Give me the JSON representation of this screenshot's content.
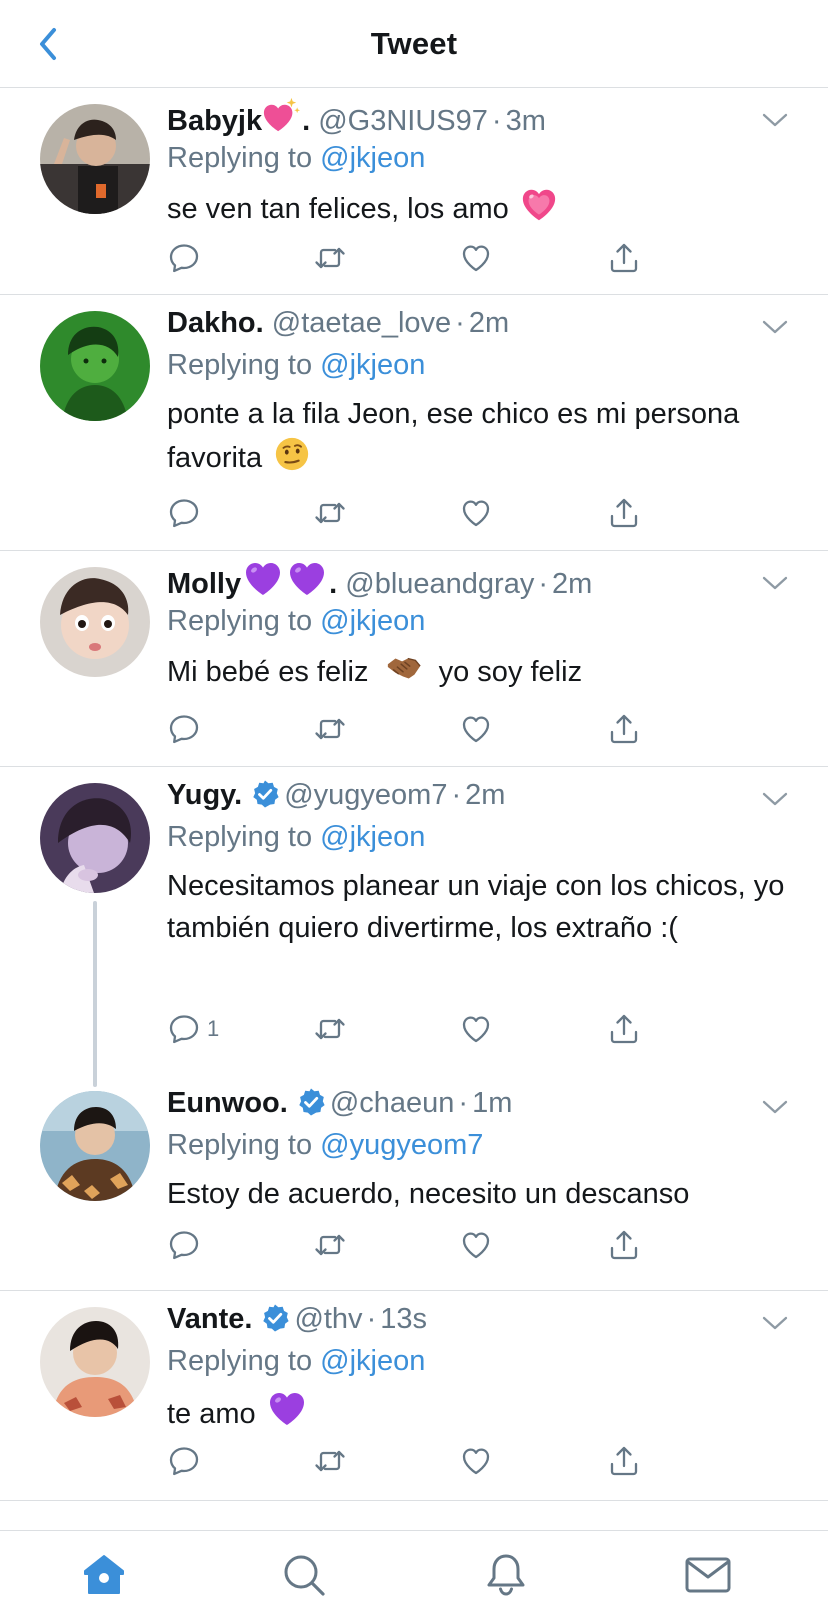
{
  "header": {
    "title": "Tweet",
    "back_icon": "chevron-left-icon"
  },
  "colors": {
    "accent": "#3b8fd9",
    "muted": "#657786",
    "divider": "#dcdfe2",
    "verified": "#3b8fd9"
  },
  "tweets": [
    {
      "name": "Babyjk",
      "name_suffix": ".",
      "name_emoji": "sparkling-pink-heart",
      "handle": "@G3NIUS97",
      "time": "3m",
      "replying_prefix": "Replying to",
      "replying_to": "@jkjeon",
      "text": "se ven tan felices, los amo",
      "text_emoji": "growing-pink-heart",
      "verified": false,
      "reply_count": ""
    },
    {
      "name": "Dakho.",
      "handle": "@taetae_love",
      "time": "2m",
      "replying_prefix": "Replying to",
      "replying_to": "@jkjeon",
      "text": "ponte a la fila Jeon, ese chico es mi persona favorita",
      "text_emoji": "raised-eyebrow-face",
      "verified": false,
      "reply_count": ""
    },
    {
      "name": "Molly",
      "name_suffix": ".",
      "name_emoji": "purple-heart",
      "handle": "@blueandgray",
      "time": "2m",
      "replying_prefix": "Replying to",
      "replying_to": "@jkjeon",
      "text_before": "Mi bebé es feliz",
      "text_after": "yo soy feliz",
      "text_emoji": "handshake",
      "verified": false,
      "reply_count": ""
    },
    {
      "name": "Yugy.",
      "handle": "@yugyeom7",
      "time": "2m",
      "replying_prefix": "Replying to",
      "replying_to": "@jkjeon",
      "text": "Necesitamos planear un viaje con los chicos, yo también quiero divertirme, los extraño :(",
      "verified": true,
      "reply_count": "1"
    },
    {
      "name": "Eunwoo.",
      "handle": "@chaeun",
      "time": "1m",
      "replying_prefix": "Replying to",
      "replying_to": "@yugyeom7",
      "text": "Estoy de acuerdo, necesito un descanso",
      "verified": true,
      "reply_count": ""
    },
    {
      "name": "Vante.",
      "handle": "@thv",
      "time": "13s",
      "replying_prefix": "Replying to",
      "replying_to": "@jkjeon",
      "text": "te amo",
      "text_emoji": "purple-heart",
      "verified": true,
      "reply_count": ""
    }
  ],
  "separator": "·",
  "action_icons": [
    "reply-icon",
    "retweet-icon",
    "like-icon",
    "share-icon"
  ],
  "tabbar": {
    "items": [
      "home-icon",
      "search-icon",
      "notifications-icon",
      "messages-icon"
    ],
    "active": "home-icon"
  }
}
